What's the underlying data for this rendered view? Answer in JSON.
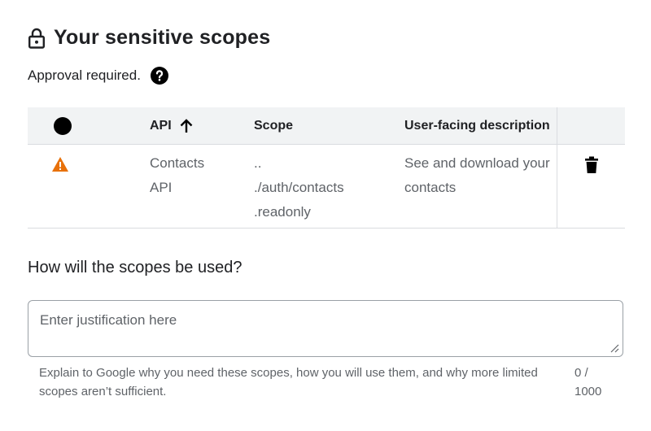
{
  "section": {
    "title": "Your sensitive scopes",
    "title_icon": "lock-icon",
    "approval_text": "Approval required.",
    "help_icon": "help-circle-icon"
  },
  "table": {
    "headers": {
      "status_icon": "status-dot-icon",
      "api": "API",
      "api_sort_icon": "arrow-up-icon",
      "scope": "Scope",
      "description": "User-facing description"
    },
    "rows": [
      {
        "status_icon": "warning-icon",
        "status_color": "#e8710a",
        "api_line1": "Contacts",
        "api_line2": "API",
        "scope_line1": "..",
        "scope_line2": "./auth/contacts",
        "scope_line3": ".readonly",
        "description_line1": "See and download your",
        "description_line2": "contacts",
        "action_icon": "delete-icon"
      }
    ]
  },
  "justification": {
    "question": "How will the scopes be used?",
    "placeholder": "Enter justification here",
    "value": "",
    "hint": "Explain to Google why you need these scopes, how you will use them, and why more limited scopes aren’t sufficient.",
    "counter_line1": "0 /",
    "counter_line2": "1000"
  }
}
